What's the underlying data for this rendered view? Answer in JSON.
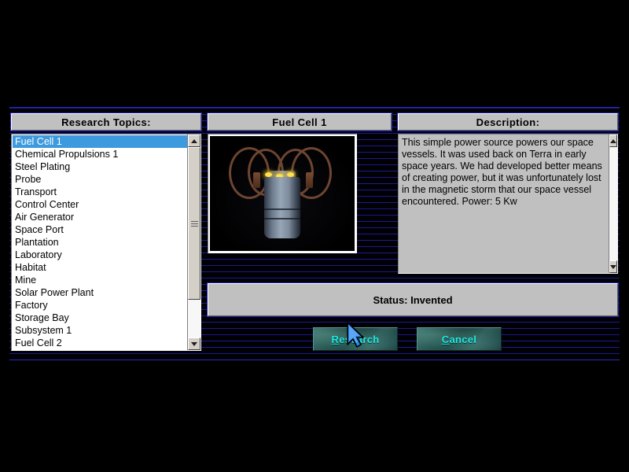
{
  "headers": {
    "topics": "Research Topics:",
    "item_name": "Fuel Cell 1",
    "description": "Description:"
  },
  "topics_list": {
    "selected_index": 0,
    "items": [
      "Fuel Cell 1",
      "Chemical Propulsions 1",
      "Steel Plating",
      "Probe",
      "Transport",
      "Control Center",
      "Air Generator",
      "Space Port",
      "Plantation",
      "Laboratory",
      "Habitat",
      "Mine",
      "Solar Power Plant",
      "Factory",
      "Storage Bay",
      "Subsystem 1",
      "Fuel Cell 2"
    ]
  },
  "description": {
    "body": "This simple power source powers our space vessels.  It was used back on Terra in early space years. We had developed better means of creating power, but it was unfortunately lost in the magnetic storm that our space vessel encountered.  Power: 5 Kw"
  },
  "status": {
    "text": "Status: Invented"
  },
  "buttons": {
    "research": {
      "accel": "R",
      "rest": "esearch"
    },
    "cancel": {
      "accel": "C",
      "rest": "ancel"
    }
  },
  "preview": {
    "alt": "fuel-cell-render"
  },
  "colors": {
    "selection_blue": "#3d9ade",
    "plate_grey": "#c0c0c0",
    "scanline_navy": "#1b1b8c",
    "button_teal": "#2b5a56",
    "button_text_cyan": "#1fe8e0",
    "backdrop_black": "#000000"
  }
}
